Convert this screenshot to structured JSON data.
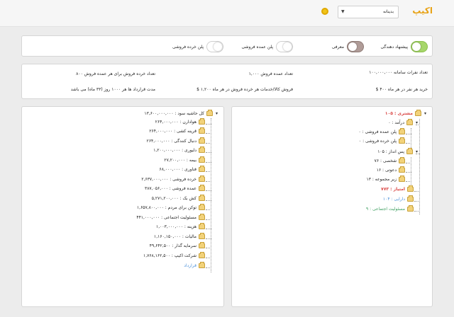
{
  "header": {
    "logo_text": "اکیپ",
    "city_selected": "بدینانه"
  },
  "toggles": [
    {
      "label": "پیشنهاد دهندگی",
      "state": "on-green"
    },
    {
      "label": "معرفی",
      "state": "on-gray"
    },
    {
      "label": "پلن عمده فروشی",
      "state": "off"
    },
    {
      "label": "پلن خرده فروشی",
      "state": "off"
    }
  ],
  "info": {
    "row1": [
      "تعداد نفرات سامانه ۱۰۰,۰۰۰,۰۰۰",
      "تعداد عمده فروش ۱,۰۰۰",
      "تعداد خرده فروش برای هر عمده فروش ۸۰۰"
    ],
    "row2": [
      "خرید هر نفر در هر ماه ۴۰۰ $",
      "فروش کالا/خدمات هر خرده فروش در هر ماه ۱,۲۰۰ $",
      "مدت قرارداد ها هر ۱۰۰۰ روز (۳۳ ماه) می باشد"
    ]
  },
  "right_tree": [
    {
      "text": "مشتری : ۱۰۵",
      "color": "red"
    },
    {
      "text": "درآمد : ۰",
      "color": ""
    },
    {
      "text": "پلن عمده فروشی : ۰",
      "color": ""
    },
    {
      "text": "پلن خرده فروشی : ۰",
      "color": ""
    },
    {
      "text": "پس انداز : ۱۰۵",
      "color": ""
    },
    {
      "text": "شخصی : ۷۶",
      "color": ""
    },
    {
      "text": "دعوتی : ۱۶",
      "color": ""
    },
    {
      "text": "زیر مجموعه : ۱۳",
      "color": ""
    },
    {
      "text": "امتیاز : ۷۷۳",
      "color": "red"
    },
    {
      "text": "دارایی : ۱۰۴",
      "color": "blue"
    },
    {
      "text": "مسئولیت اجتماعی : ۹",
      "color": "green"
    }
  ],
  "left_tree": [
    {
      "text": "کل حاشیه سود : ۱۳,۶۰۰,۰۰۰,۰۰۰",
      "color": ""
    },
    {
      "text": "هوادارن : ۲۶۴,۰۰۰,۰۰۰",
      "color": ""
    },
    {
      "text": "قرینه کشی : ۲۶۴,۰۰۰,۰۰۰",
      "color": ""
    },
    {
      "text": "دنبال کنندگی : ۲۶۴,۰۰۰,۰۰۰",
      "color": ""
    },
    {
      "text": "دلیوری : ۱,۲۰۰,۰۰۰,۰۰۰",
      "color": ""
    },
    {
      "text": "بیمه : ۲۷,۲۰۰,۰۰۰",
      "color": ""
    },
    {
      "text": "فناوری : ۶۸,۰۰۰,۰۰۰",
      "color": ""
    },
    {
      "text": "خرده فروشی : ۲,۶۳۷,۰۰۰,۰۰۰",
      "color": ""
    },
    {
      "text": "عمده فروشی : ۳۸۷,۰۵۶,۰۰۰",
      "color": ""
    },
    {
      "text": "کش بک : ۵,۲۷۱,۲۰۰,۰۰۰",
      "color": ""
    },
    {
      "text": "توکن برای مردم : ۱,۶۵۷,۸۰۰,۰۰۰",
      "color": ""
    },
    {
      "text": "مسئولیت اجتماعی : ۴۴۱,۰۰۰,۰۰۰",
      "color": ""
    },
    {
      "text": "هزینه : ۱,۰۰۳,۰۰۰,۰۰۰",
      "color": ""
    },
    {
      "text": "مالیات : ۱,۱۶۰,۱۵۰,۰۰۰",
      "color": ""
    },
    {
      "text": "سرمایه گذار : ۴۹,۶۴۲,۵۰۰",
      "color": ""
    },
    {
      "text": "شرکت اکیپ : ۱,۷۶۸,۱۶۲,۵۰۰",
      "color": ""
    },
    {
      "text": "قرارداد",
      "color": "blue"
    }
  ]
}
